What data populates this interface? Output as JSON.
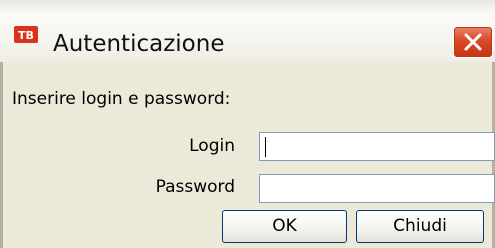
{
  "window": {
    "title": "Autenticazione",
    "app_icon": "tb-logo-icon",
    "close_icon": "close-icon"
  },
  "form": {
    "instruction": "Inserire login e password:",
    "login_label": "Login",
    "login_value": "",
    "password_label": "Password",
    "password_value": ""
  },
  "buttons": {
    "ok_label": "OK",
    "close_label": "Chiudi"
  },
  "colors": {
    "app_icon_red": "#d9321f",
    "close_button_red": "#d94a2a",
    "dialog_background": "#ece9d8",
    "input_border": "#7f9db9",
    "button_border": "#003c74"
  }
}
